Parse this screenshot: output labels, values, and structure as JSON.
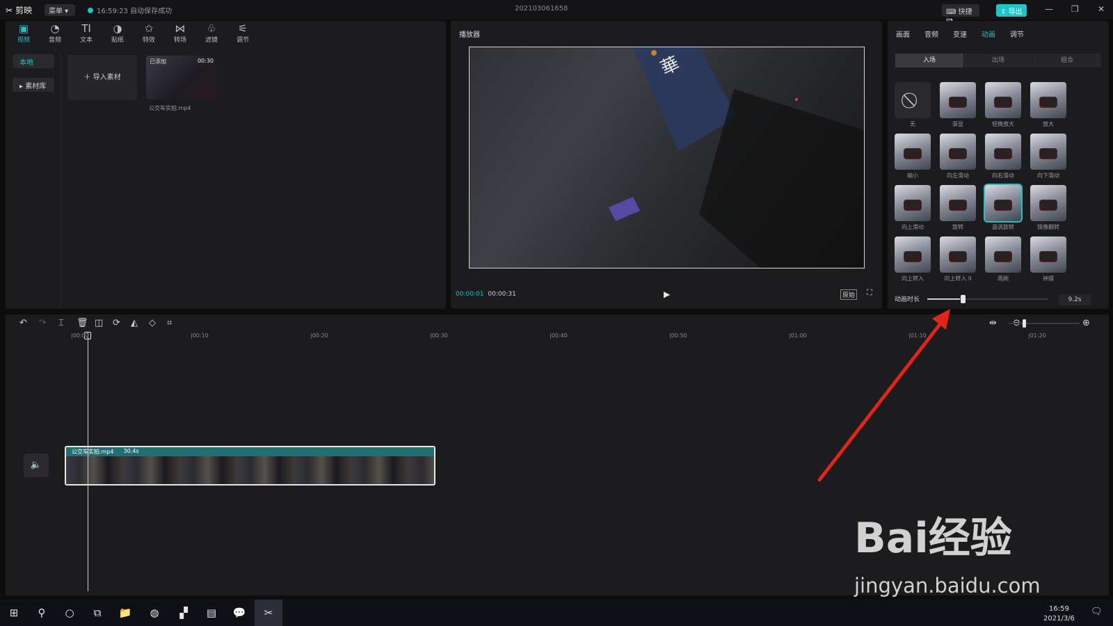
{
  "app": {
    "name": "剪映",
    "menu": "菜单",
    "autosave": "16:59:23 自动保存成功",
    "project_title": "202103061658",
    "shortcut_btn": "快捷键",
    "export_btn": "导出"
  },
  "toolbar": [
    {
      "label": "视频",
      "icon": "video-icon",
      "glyph": "▣"
    },
    {
      "label": "音频",
      "icon": "audio-icon",
      "glyph": "◔"
    },
    {
      "label": "文本",
      "icon": "text-icon",
      "glyph": "TI"
    },
    {
      "label": "贴纸",
      "icon": "sticker-icon",
      "glyph": "◑"
    },
    {
      "label": "特效",
      "icon": "effects-icon",
      "glyph": "✩"
    },
    {
      "label": "转场",
      "icon": "transition-icon",
      "glyph": "⋈"
    },
    {
      "label": "滤镜",
      "icon": "filter-icon",
      "glyph": "♧"
    },
    {
      "label": "调节",
      "icon": "adjust-icon",
      "glyph": "⚟"
    }
  ],
  "sidebar": {
    "local": "本地",
    "library": "素材库"
  },
  "media": {
    "import_label": "导入素材",
    "clip": {
      "badge": "已添加",
      "duration": "00:30",
      "name": "公交车实拍.mp4"
    }
  },
  "player": {
    "title": "播放器",
    "current": "00:00:01",
    "total": "00:00:31",
    "original": "原始"
  },
  "props": {
    "tabs": [
      "画面",
      "音频",
      "变速",
      "动画",
      "调节"
    ],
    "active_tab": "动画",
    "subtabs": [
      "入场",
      "出场",
      "组合"
    ],
    "animations": [
      "无",
      "渐显",
      "轻微放大",
      "放大",
      "缩小",
      "向左滑动",
      "向右滑动",
      "向下滑动",
      "向上滑动",
      "旋转",
      "漩涡旋转",
      "镜像翻转",
      "向上转入",
      "向上转入 II",
      "雨刷",
      "钟摆"
    ],
    "selected_animation": "漩涡旋转",
    "duration_label": "动画时长",
    "duration_value": "9.2s",
    "duration_fraction": 0.27
  },
  "timeline": {
    "ticks": [
      "00:00",
      "00:10",
      "00:20",
      "00:30",
      "00:40",
      "00:50",
      "01:00",
      "01:10",
      "01:20"
    ],
    "clip_name": "公交车实拍.mp4",
    "clip_duration": "30.4s"
  },
  "taskbar": {
    "time": "16:59",
    "date": "2021/3/6"
  },
  "watermark": {
    "brand": "Bai经验",
    "url": "jingyan.baidu.com"
  },
  "colors": {
    "accent": "#21c3c7",
    "background": "#1c1c1f",
    "arrow": "#e3241c"
  }
}
